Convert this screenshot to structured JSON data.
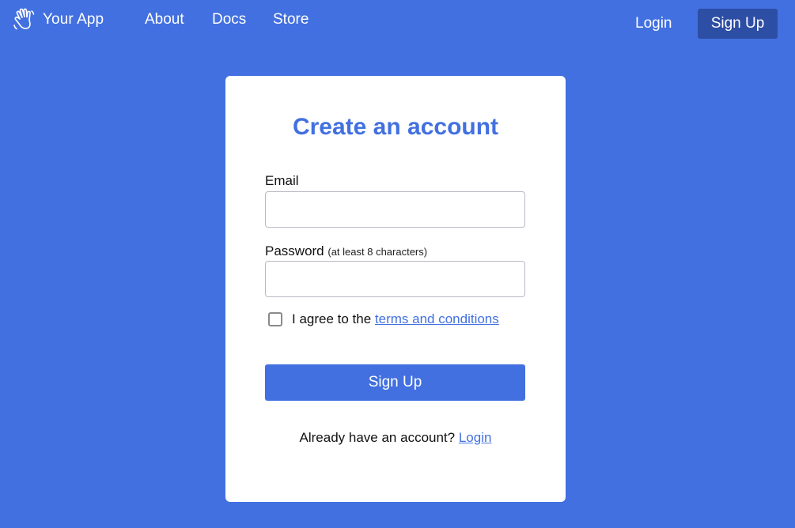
{
  "nav": {
    "brand": "Your App",
    "brand_icon": "waving-hand-icon",
    "links": [
      "About",
      "Docs",
      "Store"
    ],
    "login": "Login",
    "signup": "Sign Up"
  },
  "form": {
    "title": "Create an account",
    "email_label": "Email",
    "email_value": "",
    "password_label": "Password",
    "password_hint": "(at least 8 characters)",
    "password_value": "",
    "agree_prefix": "I agree to the ",
    "terms_link": "terms and conditions",
    "terms_checked": false,
    "submit": "Sign Up",
    "footer_prefix": "Already have an account? ",
    "footer_link": "Login"
  },
  "colors": {
    "background": "#4270e0",
    "accent": "#4270e0",
    "nav_button": "#2d4ea5",
    "card": "#ffffff"
  }
}
